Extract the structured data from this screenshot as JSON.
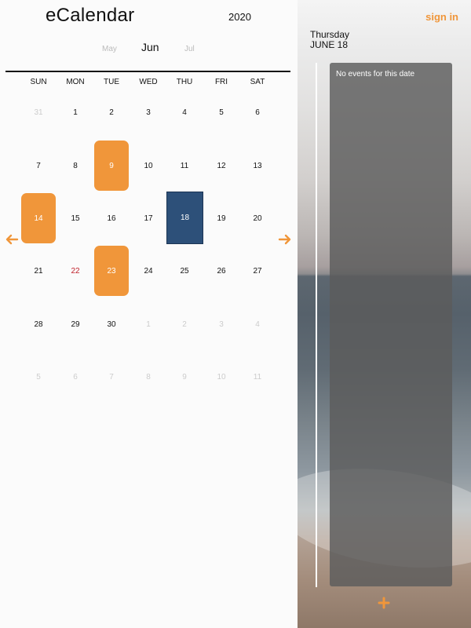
{
  "app": {
    "title": "eCalendar"
  },
  "calendar": {
    "year": "2020",
    "prev_month": "May",
    "current_month": "Jun",
    "next_month": "Jul",
    "weekdays": [
      "SUN",
      "MON",
      "TUE",
      "WED",
      "THU",
      "FRI",
      "SAT"
    ],
    "weeks": [
      [
        {
          "d": "31",
          "state": "muted"
        },
        {
          "d": "1"
        },
        {
          "d": "2"
        },
        {
          "d": "3"
        },
        {
          "d": "4"
        },
        {
          "d": "5"
        },
        {
          "d": "6"
        }
      ],
      [
        {
          "d": "7"
        },
        {
          "d": "8"
        },
        {
          "d": "9",
          "state": "event"
        },
        {
          "d": "10"
        },
        {
          "d": "11"
        },
        {
          "d": "12"
        },
        {
          "d": "13"
        }
      ],
      [
        {
          "d": "14",
          "state": "event"
        },
        {
          "d": "15"
        },
        {
          "d": "16"
        },
        {
          "d": "17"
        },
        {
          "d": "18",
          "state": "selected"
        },
        {
          "d": "19"
        },
        {
          "d": "20"
        }
      ],
      [
        {
          "d": "21"
        },
        {
          "d": "22",
          "state": "holiday"
        },
        {
          "d": "23",
          "state": "event"
        },
        {
          "d": "24"
        },
        {
          "d": "25"
        },
        {
          "d": "26"
        },
        {
          "d": "27"
        }
      ],
      [
        {
          "d": "28"
        },
        {
          "d": "29"
        },
        {
          "d": "30"
        },
        {
          "d": "1",
          "state": "muted"
        },
        {
          "d": "2",
          "state": "muted"
        },
        {
          "d": "3",
          "state": "muted"
        },
        {
          "d": "4",
          "state": "muted"
        }
      ],
      [
        {
          "d": "5",
          "state": "muted"
        },
        {
          "d": "6",
          "state": "muted"
        },
        {
          "d": "7",
          "state": "muted"
        },
        {
          "d": "8",
          "state": "muted"
        },
        {
          "d": "9",
          "state": "muted"
        },
        {
          "d": "10",
          "state": "muted"
        },
        {
          "d": "11",
          "state": "muted"
        }
      ]
    ],
    "nav": {
      "prev_icon": "arrow-left-icon",
      "next_icon": "arrow-right-icon"
    }
  },
  "panel": {
    "sign_in_label": "sign in",
    "selected_weekday": "Thursday",
    "selected_date": "JUNE 18",
    "empty_message": "No events for this date",
    "add_icon": "plus-icon"
  },
  "colors": {
    "accent": "#f0963a",
    "selected": "#2d5079",
    "holiday": "#c0202a",
    "muted": "#cccccc"
  }
}
